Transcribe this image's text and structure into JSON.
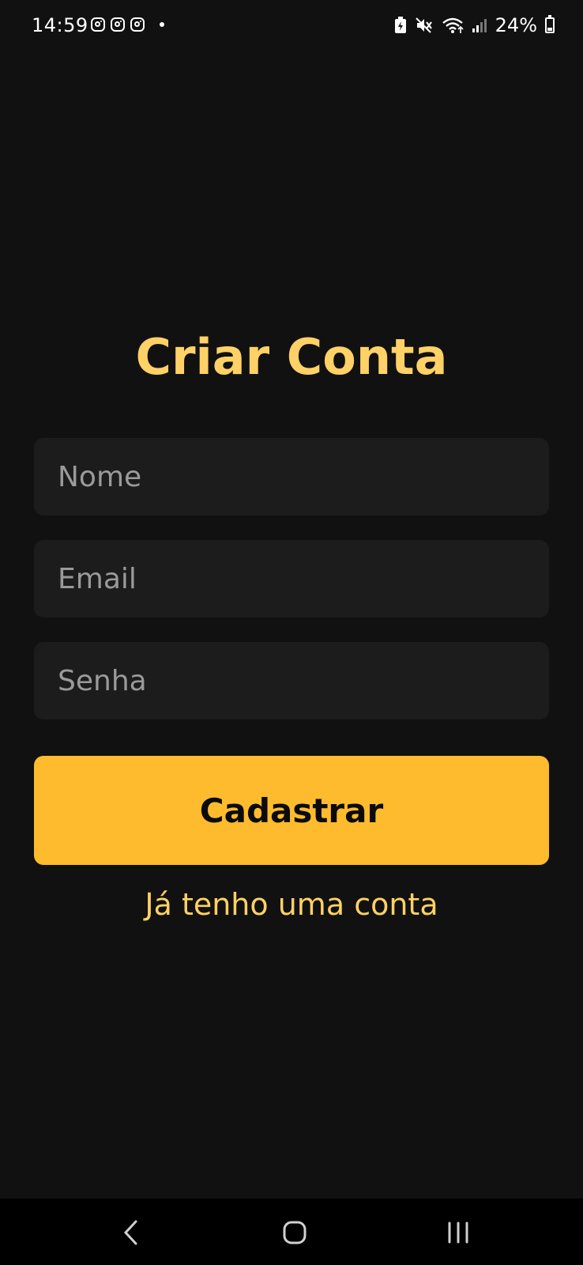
{
  "status_bar": {
    "time": "14:59",
    "notification_icons": [
      "instagram-icon",
      "instagram-icon",
      "instagram-icon",
      "dot-icon"
    ],
    "system_icons": [
      "battery-saver-icon",
      "mute-icon",
      "wifi-icon",
      "signal-icon"
    ],
    "battery_percent": "24%"
  },
  "screen": {
    "title": "Criar Conta",
    "fields": {
      "name_placeholder": "Nome",
      "email_placeholder": "Email",
      "password_placeholder": "Senha"
    },
    "submit_label": "Cadastrar",
    "login_link": "Já tenho uma conta"
  },
  "nav_bar": {
    "icons": [
      "back-icon",
      "home-icon",
      "recent-apps-icon"
    ]
  },
  "colors": {
    "background": "#111111",
    "accent": "#FDBB2D",
    "title": "#FFD166",
    "field_background": "#1C1C1C",
    "placeholder": "#9A9A9A"
  }
}
